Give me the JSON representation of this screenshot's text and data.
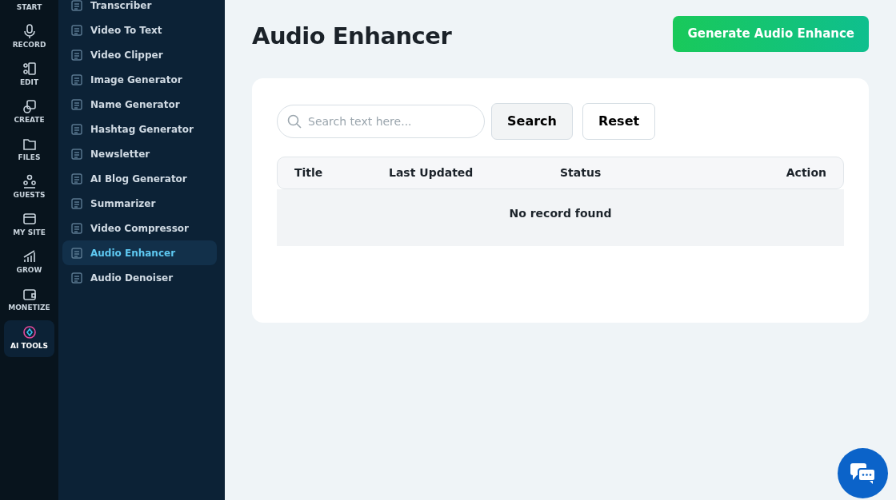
{
  "rail": [
    {
      "label": "START",
      "selected": false
    },
    {
      "label": "RECORD",
      "selected": false
    },
    {
      "label": "EDIT",
      "selected": false
    },
    {
      "label": "CREATE",
      "selected": false
    },
    {
      "label": "FILES",
      "selected": false
    },
    {
      "label": "GUESTS",
      "selected": false
    },
    {
      "label": "MY SITE",
      "selected": false
    },
    {
      "label": "GROW",
      "selected": false
    },
    {
      "label": "MONETIZE",
      "selected": false
    },
    {
      "label": "AI TOOLS",
      "selected": true
    }
  ],
  "submenu": [
    {
      "label": "Transcriber",
      "selected": false
    },
    {
      "label": "Video To Text",
      "selected": false
    },
    {
      "label": "Video Clipper",
      "selected": false
    },
    {
      "label": "Image Generator",
      "selected": false
    },
    {
      "label": "Name Generator",
      "selected": false
    },
    {
      "label": "Hashtag Generator",
      "selected": false
    },
    {
      "label": "Newsletter",
      "selected": false
    },
    {
      "label": "AI Blog Generator",
      "selected": false
    },
    {
      "label": "Summarizer",
      "selected": false
    },
    {
      "label": "Video Compressor",
      "selected": false
    },
    {
      "label": "Audio Enhancer",
      "selected": true
    },
    {
      "label": "Audio Denoiser",
      "selected": false
    }
  ],
  "page": {
    "title": "Audio Enhancer",
    "primary_button": "Generate Audio Enhance"
  },
  "search": {
    "placeholder": "Search text here...",
    "search_button": "Search",
    "reset_button": "Reset"
  },
  "table": {
    "columns": [
      "Title",
      "Last Updated",
      "Status",
      "Action"
    ],
    "empty_message": "No record found"
  }
}
